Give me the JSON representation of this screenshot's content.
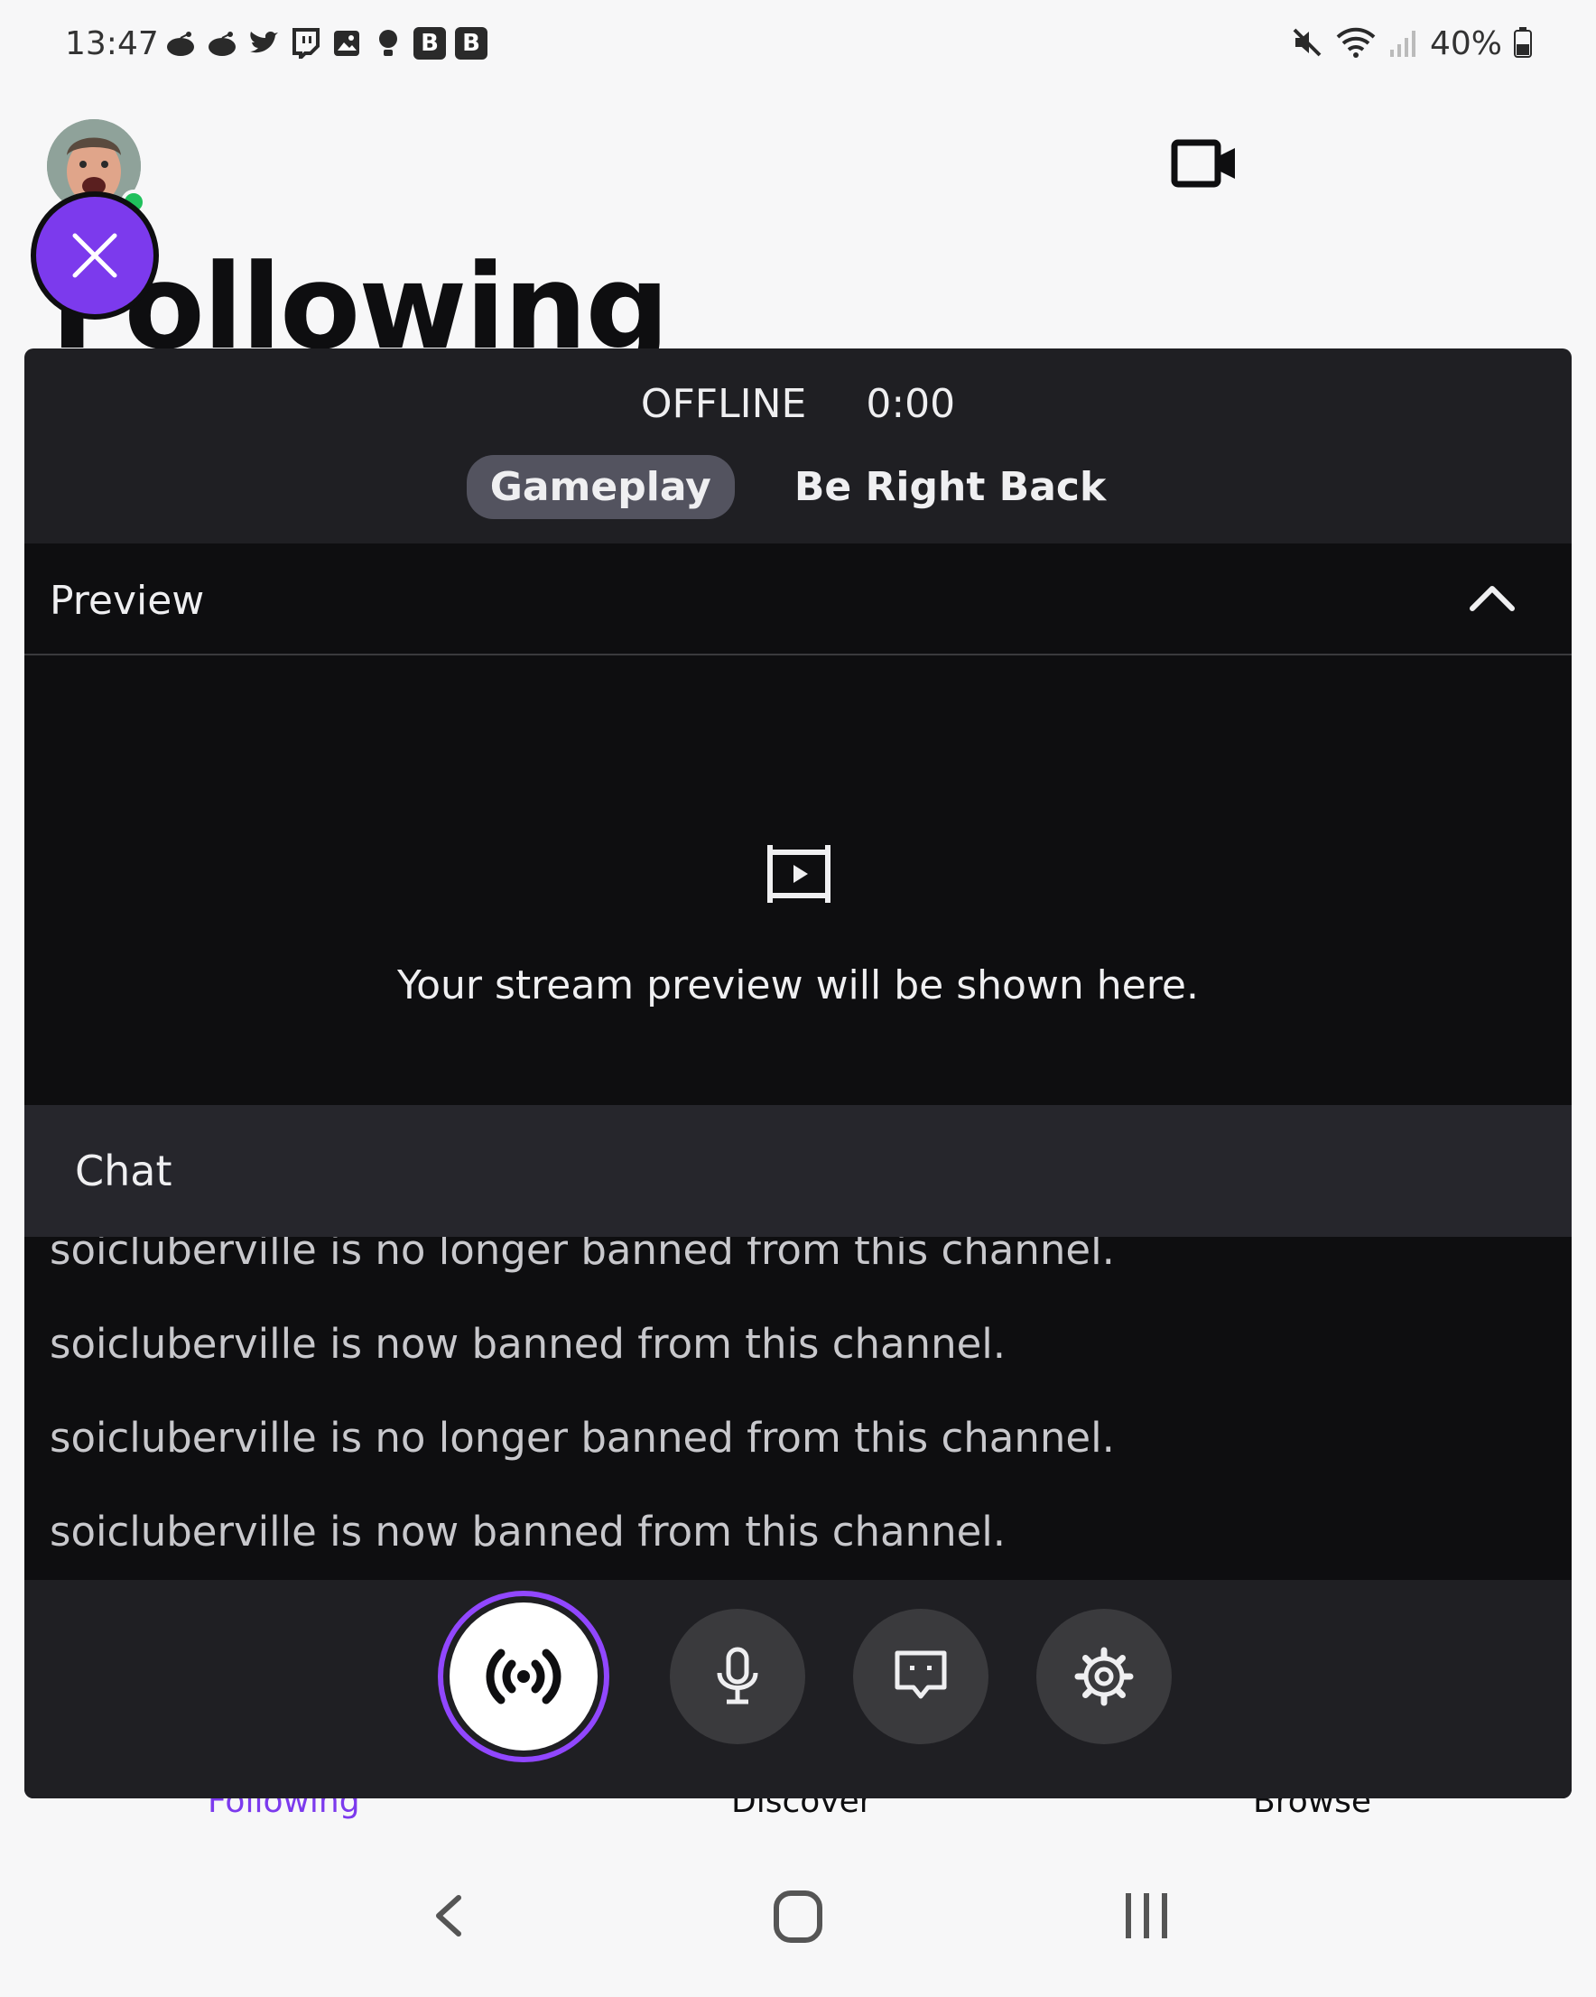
{
  "status_bar": {
    "time": "13:47",
    "notification_icons": [
      "reddit-icon",
      "reddit-icon",
      "twitter-icon",
      "twitch-icon",
      "gallery-icon",
      "bulb-icon"
    ],
    "badge_letters": [
      "B",
      "B"
    ],
    "battery": "40%"
  },
  "page": {
    "title": "Following"
  },
  "bottom_nav": {
    "following": "Following",
    "discover": "Discover",
    "browse": "Browse"
  },
  "stream": {
    "status": "OFFLINE",
    "timer": "0:00",
    "scenes": [
      "Gameplay",
      "Be Right Back"
    ],
    "active_scene": "Gameplay",
    "preview_label": "Preview",
    "preview_message": "Your stream preview will be shown here.",
    "chat_label": "Chat",
    "chat_messages": [
      "soicluberville is no longer banned from this channel.",
      "soicluberville is now banned from this channel.",
      "soicluberville is no longer banned from this channel.",
      "soicluberville is now banned from this channel."
    ]
  },
  "colors": {
    "accent": "#9147ff",
    "fab": "#7c3aed",
    "overlay_bg": "#1f1f23",
    "online": "#20c05c"
  }
}
